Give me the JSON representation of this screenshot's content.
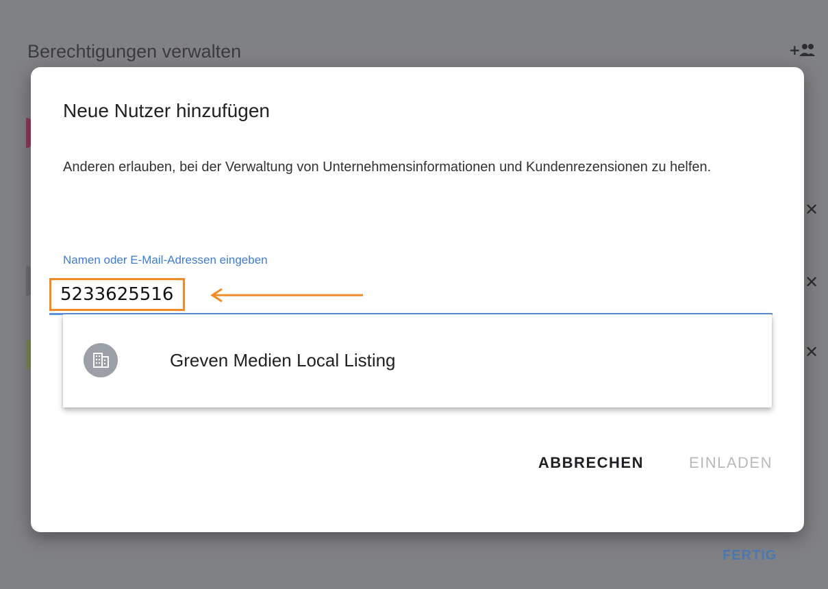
{
  "background": {
    "title": "Berechtigungen verwalten",
    "done_label": "FERTIG",
    "add_user_icon": "person-add-icon",
    "close_icon": "close-icon",
    "accent": "#4a79b0"
  },
  "dialog": {
    "title": "Neue Nutzer hinzufügen",
    "description": "Anderen erlauben, bei der Verwaltung von Unternehmensinformationen und Kundenrezensionen zu helfen.",
    "field": {
      "label": "Namen oder E-Mail-Adressen eingeben",
      "value": "5233625516"
    },
    "suggestion": {
      "icon": "business-building-icon",
      "label": "Greven Medien Local Listing"
    },
    "actions": {
      "cancel_label": "ABBRECHEN",
      "invite_label": "EINLADEN"
    }
  },
  "annotation": {
    "highlight_color": "#f08a24",
    "arrow_icon": "arrow-left-icon"
  }
}
